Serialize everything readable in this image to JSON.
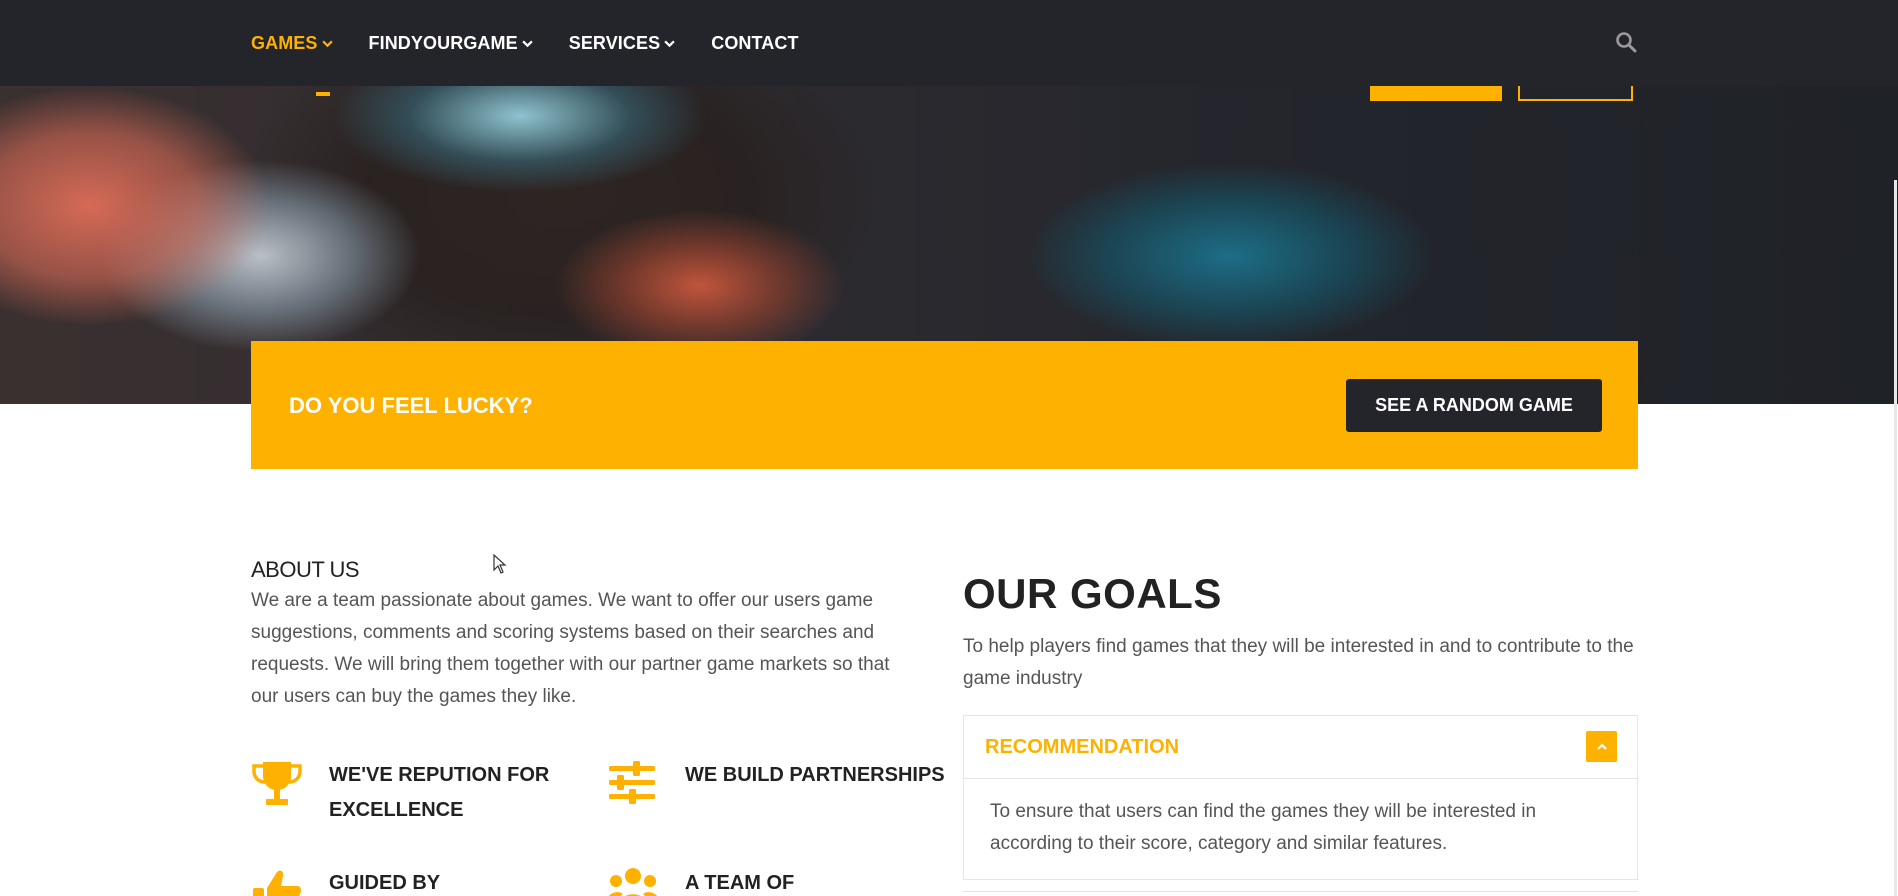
{
  "nav": {
    "items": [
      {
        "label": "GAMES",
        "active": true,
        "has_dropdown": true
      },
      {
        "label": "FINDYOURGAME",
        "active": false,
        "has_dropdown": true
      },
      {
        "label": "SERVICES",
        "active": false,
        "has_dropdown": true
      },
      {
        "label": "CONTACT",
        "active": false,
        "has_dropdown": false
      }
    ],
    "search_icon": "search-icon"
  },
  "colors": {
    "accent": "#ffb100",
    "dark": "#24252b",
    "text_dark": "#222222",
    "text_muted": "#555555"
  },
  "lucky": {
    "text": "DO YOU FEEL LUCKY?",
    "button_label": "SEE A RANDOM GAME"
  },
  "about": {
    "title": "ABOUT US",
    "text": "We are a team passionate about games. We want to offer our users game suggestions, comments and scoring systems based on their searches and requests. We will bring them together with our partner game markets so that our users can buy the games they like.",
    "features": [
      {
        "label": "WE'VE REPUTION FOR EXCELLENCE",
        "icon": "trophy-icon"
      },
      {
        "label": "WE BUILD PARTNERSHIPS",
        "icon": "sliders-icon"
      },
      {
        "label": "GUIDED BY",
        "icon": "thumbs-up-icon"
      },
      {
        "label": "A TEAM OF",
        "icon": "users-icon"
      }
    ]
  },
  "goals": {
    "title": "OUR GOALS",
    "text": "To help players find games that they will be interested in and to contribute to the game industry",
    "accordion": {
      "title": "RECOMMENDATION",
      "expanded": true,
      "body": "To ensure that users can find the games they will be interested in according to their score, category and similar features."
    }
  }
}
